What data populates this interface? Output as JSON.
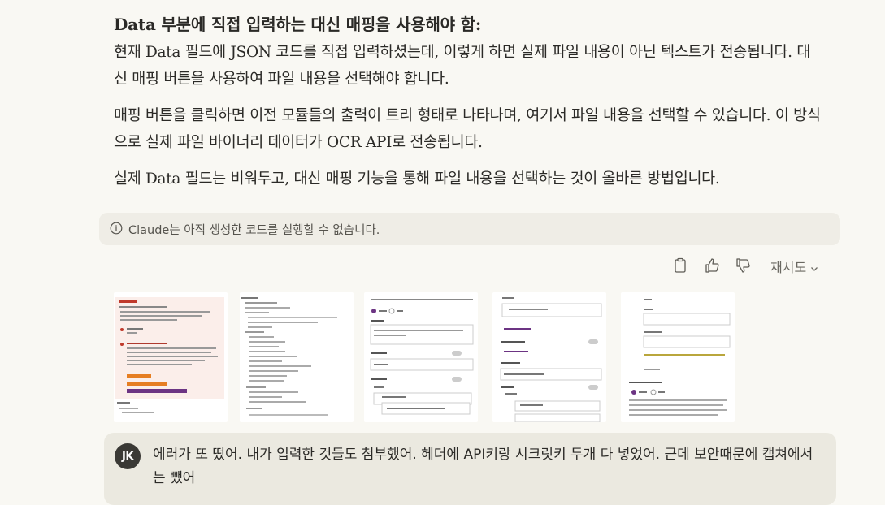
{
  "assistant": {
    "heading": "Data 부분에 직접 입력하는 대신 매핑을 사용해야 함:",
    "paragraphs": [
      "현재 Data 필드에 JSON 코드를 직접 입력하셨는데, 이렇게 하면 실제 파일 내용이 아닌 텍스트가 전송됩니다. 대신 매핑 버튼을 사용하여 파일 내용을 선택해야 합니다.",
      "매핑 버튼을 클릭하면 이전 모듈들의 출력이 트리 형태로 나타나며, 여기서 파일 내용을 선택할 수 있습니다. 이 방식으로 실제 파일 바이너리 데이터가 OCR API로 전송됩니다.",
      "실제 Data 필드는 비워두고, 대신 매핑 기능을 통해 파일 내용을 선택하는 것이 올바른 방법입니다."
    ],
    "notice": "Claude는 아직 생성한 코드를 실행할 수 없습니다.",
    "retry_label": "재시도"
  },
  "icons": {
    "info": "info-circle-icon",
    "copy": "clipboard-icon",
    "thumbs_up": "thumbs-up-icon",
    "thumbs_down": "thumbs-down-icon",
    "chevron": "chevron-down-icon"
  },
  "attachments": [
    {
      "name": "screenshot-error-dialog"
    },
    {
      "name": "screenshot-bundle-tree"
    },
    {
      "name": "screenshot-http-request-settings"
    },
    {
      "name": "screenshot-body-content-type"
    },
    {
      "name": "screenshot-parse-response"
    }
  ],
  "user": {
    "initials": "JK",
    "message": "에러가 또 떴어. 내가 입력한 것들도 첨부했어. 헤더에 API키랑 시크릿키 두개 다 넣었어. 근데 보안때문에 캡쳐에서는 뺐어"
  },
  "colors": {
    "background": "#f9f8f3",
    "notice_bg": "#efede6",
    "user_bubble": "#ebe9e0",
    "avatar": "#3a3935"
  }
}
